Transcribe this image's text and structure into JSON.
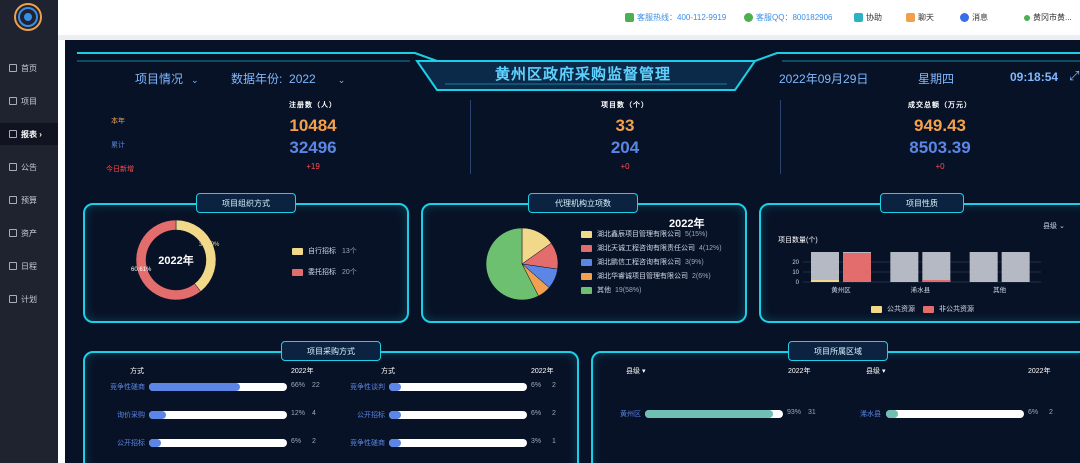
{
  "sidebar": {
    "items": [
      {
        "label": "首页",
        "icon": "home-icon"
      },
      {
        "label": "项目",
        "icon": "folder-icon"
      },
      {
        "label": "报表 ›",
        "icon": "report-icon"
      },
      {
        "label": "公告",
        "icon": "notice-icon"
      },
      {
        "label": "预算",
        "icon": "budget-icon"
      },
      {
        "label": "资产",
        "icon": "asset-icon"
      },
      {
        "label": "日程",
        "icon": "calendar-icon"
      },
      {
        "label": "计划",
        "icon": "plan-icon"
      }
    ],
    "active_index": 2
  },
  "topbar": {
    "hotline": "客服热线：400-112-9919",
    "qq": "客服QQ：800182906",
    "help": "协助",
    "chat": "聊天",
    "messages": "消息",
    "user": "黄冈市黄..."
  },
  "header": {
    "title": "黄州区政府采购监督管理",
    "project_status": "项目情况",
    "year_label": "数据年份:",
    "year_value": "2022",
    "date": "2022年09月29日",
    "weekday": "星期四",
    "time": "09:18:54"
  },
  "stats": {
    "row_labels": {
      "current_year": "本年",
      "cumulative": "累计",
      "today_new": "今日新增"
    },
    "columns": [
      {
        "title": "注册数（人）",
        "current_year": "10484",
        "cumulative": "32496",
        "today_new": "+19"
      },
      {
        "title": "项目数（个）",
        "current_year": "33",
        "cumulative": "204",
        "today_new": "+0"
      },
      {
        "title": "成交总额（万元）",
        "current_year": "949.43",
        "cumulative": "8503.39",
        "today_new": "+0"
      }
    ]
  },
  "panel_org": {
    "title": "项目组织方式",
    "center_label": "2022年",
    "labels": [
      "39.39%",
      "60.61%"
    ],
    "legend": [
      {
        "name": "自行招标",
        "count": "13个",
        "color": "#f2d98a"
      },
      {
        "name": "委托招标",
        "count": "20个",
        "color": "#e36c6c"
      }
    ]
  },
  "panel_agency": {
    "title": "代理机构立项数",
    "year": "2022年",
    "legend": [
      {
        "name": "湖北鑫辰项目管理有限公司",
        "value": "5(15%)",
        "color": "#f2d98a"
      },
      {
        "name": "湖北天诚工程咨询有限责任公司",
        "value": "4(12%)",
        "color": "#e36c6c"
      },
      {
        "name": "湖北鹏信工程咨询有限公司",
        "value": "3(9%)",
        "color": "#5b86e5"
      },
      {
        "name": "湖北华睿诚项目管理有限公司",
        "value": "2(6%)",
        "color": "#f0a050"
      },
      {
        "name": "其他",
        "value": "19(58%)",
        "color": "#6cc070"
      }
    ]
  },
  "panel_nature": {
    "title": "项目性质",
    "level_select": "县级",
    "y_label": "项目数量(个)",
    "legend_public": "公共资源",
    "legend_non_public": "非公共资源",
    "legend_public_color": "#f2d98a",
    "legend_non_public_color": "#e36c6c"
  },
  "panel_method": {
    "title": "项目采购方式",
    "col_header": "方式",
    "year": "2022年",
    "left": [
      {
        "name": "竞争性磋商",
        "pct": "66%",
        "count": "22",
        "frac": 0.66
      },
      {
        "name": "询价采购",
        "pct": "12%",
        "count": "4",
        "frac": 0.12
      },
      {
        "name": "公开招标",
        "pct": "6%",
        "count": "2",
        "frac": 0.06
      }
    ],
    "right": [
      {
        "name": "竞争性谈判",
        "pct": "6%",
        "count": "2",
        "frac": 0.06
      },
      {
        "name": "公开招标",
        "pct": "6%",
        "count": "2",
        "frac": 0.06
      },
      {
        "name": "竞争性磋商",
        "pct": "3%",
        "count": "1",
        "frac": 0.03
      }
    ],
    "bar_color": "#5b86e5"
  },
  "panel_region": {
    "title": "项目所属区域",
    "level_label": "县级",
    "year": "2022年",
    "left": [
      {
        "name": "黄州区",
        "pct": "93%",
        "count": "31",
        "frac": 0.93
      }
    ],
    "right": [
      {
        "name": "浠水县",
        "pct": "6%",
        "count": "2",
        "frac": 0.06
      }
    ],
    "bar_color": "#6fbfb3"
  },
  "chart_data": [
    {
      "type": "pie",
      "variant": "donut",
      "title": "2022年",
      "categories": [
        "自行招标",
        "委托招标"
      ],
      "values": [
        13,
        20
      ],
      "labels": [
        "39.39%",
        "60.61%"
      ],
      "colors": [
        "#f2d98a",
        "#e36c6c"
      ]
    },
    {
      "type": "pie",
      "title": "2022年",
      "categories": [
        "湖北鑫辰项目管理有限公司",
        "湖北天诚工程咨询有限责任公司",
        "湖北鹏信工程咨询有限公司",
        "湖北华睿诚项目管理有限公司",
        "其他"
      ],
      "values": [
        5,
        4,
        3,
        2,
        19
      ],
      "colors": [
        "#f2d98a",
        "#e36c6c",
        "#5b86e5",
        "#f0a050",
        "#6cc070"
      ]
    },
    {
      "type": "bar",
      "categories": [
        "黄州区",
        "浠水县",
        "其他"
      ],
      "ylabel": "项目数量(个)",
      "yticks": [
        "20",
        "10",
        "0"
      ],
      "ylim": [
        0,
        30
      ],
      "series": [
        {
          "name": "公共资源",
          "values": [
            2,
            0,
            0
          ],
          "color": "#f2d98a"
        },
        {
          "name": "非公共资源",
          "values": [
            29,
            2,
            0
          ],
          "color": "#e36c6c"
        }
      ]
    }
  ]
}
